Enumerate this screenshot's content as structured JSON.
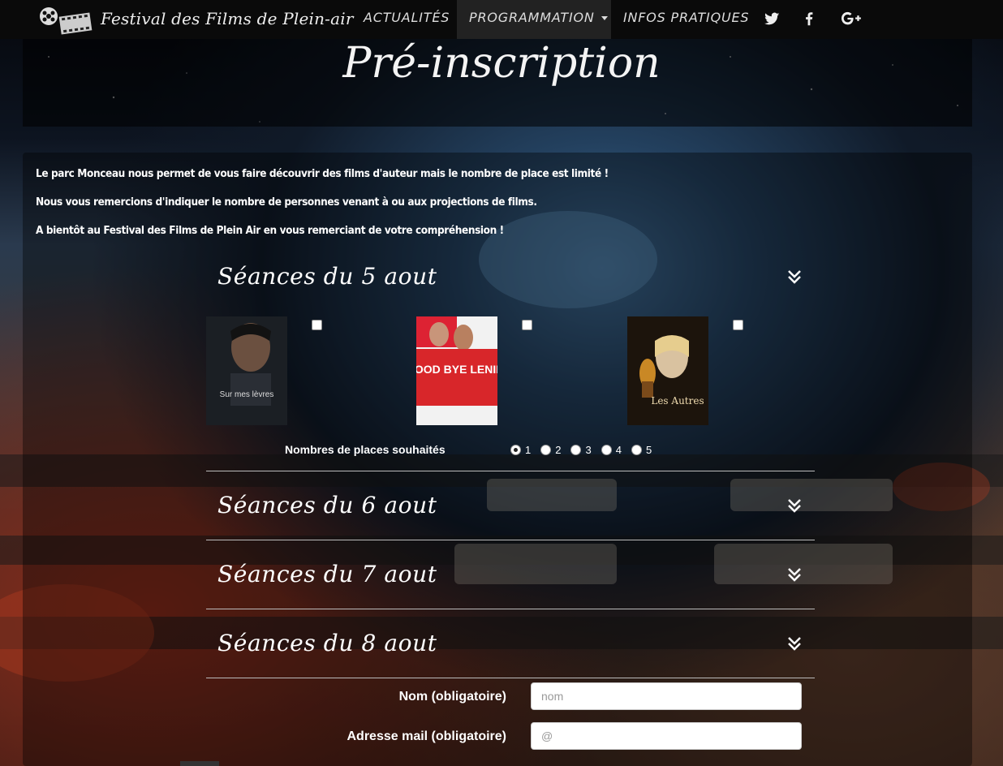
{
  "navbar": {
    "brand": "Festival des Films de Plein-air",
    "items": [
      {
        "label": "ACTUALITÉS"
      },
      {
        "label": "PROGRAMMATION"
      },
      {
        "label": "INFOS PRATIQUES"
      }
    ],
    "social": [
      "twitter-icon",
      "facebook-icon",
      "google-plus-icon"
    ]
  },
  "page": {
    "title": "Pré-inscription",
    "intro": [
      "Le parc Monceau nous permet de vous faire découvrir des films d'auteur mais le nombre de place est limité !",
      "Nous vous remercions d'indiquer le nombre de personnes venant à ou aux projections de films.",
      "A bientôt au Festival des Films de Plein Air en vous remerciant de votre compréhension !"
    ]
  },
  "sections": [
    {
      "title": "Séances du 5 aout",
      "expanded": true
    },
    {
      "title": "Séances du 6 aout",
      "expanded": false
    },
    {
      "title": "Séances du 7 aout",
      "expanded": false
    },
    {
      "title": "Séances du 8 aout",
      "expanded": false
    }
  ],
  "films": [
    {
      "poster_title": "Sur mes lèvres",
      "checked": false
    },
    {
      "poster_title": "GOOD BYE LENIN!",
      "checked": false
    },
    {
      "poster_title": "Les Autres",
      "checked": false
    }
  ],
  "places": {
    "label": "Nombres de places souhaités",
    "options": [
      "1",
      "2",
      "3",
      "4",
      "5"
    ],
    "selected": "1"
  },
  "form": {
    "name_label": "Nom (obligatoire)",
    "name_placeholder": "nom",
    "email_label": "Adresse mail (obligatoire)",
    "email_placeholder": "@"
  }
}
